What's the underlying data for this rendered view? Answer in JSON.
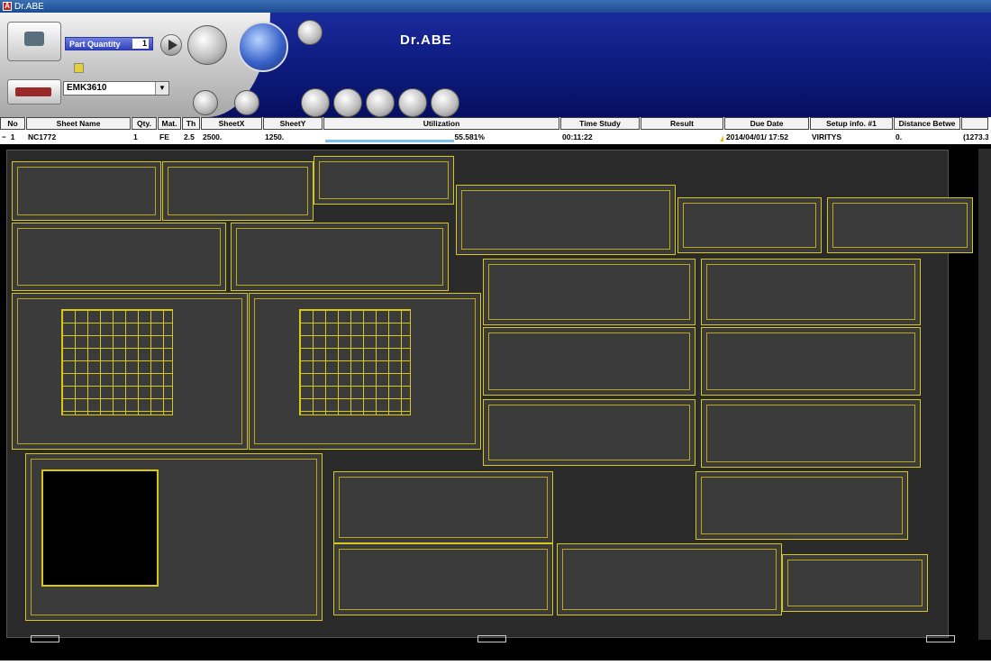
{
  "window": {
    "title": "Dr.ABE"
  },
  "header": {
    "brand": "Dr.ABE",
    "part_quantity_label": "Part Quantity",
    "part_quantity_value": "1",
    "machine": "EMK3610"
  },
  "table": {
    "columns": [
      "No",
      "Sheet Name",
      "Qty.",
      "Mat.",
      "Th",
      "SheetX",
      "SheetY",
      "Utilization",
      "Time Study",
      "Result",
      "Due Date",
      "Setup info. #1",
      "Distance Betwe"
    ],
    "row": {
      "expand": "−",
      "no": "1",
      "sheet_name": "NC1772",
      "qty": "1",
      "mat": "FE",
      "th": "2.5",
      "sheetx": "2500.",
      "sheety": "1250.",
      "utilization": "55.581%",
      "utilization_fraction": 0.5558,
      "time_study": "00:11:22",
      "result": "2",
      "due_date": "2014/04/01/ 17:52",
      "setup_info": "VIRITYS",
      "distance": "0.",
      "extra": "(1273.3"
    }
  },
  "colors": {
    "part_outline": "#d8c816",
    "sheet_bg": "#2a2a2a",
    "header_blue": "#0c1a7c"
  }
}
